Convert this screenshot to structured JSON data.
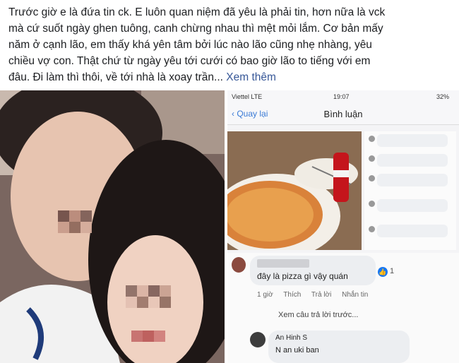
{
  "post": {
    "lines": [
      "Trước giờ e là đứa tin ck. E luôn quan niệm đã yêu là phải tin, hơn nữa là vck",
      "mà cứ suốt ngày ghen tuông, canh chừng nhau thì mệt mỏi lắm. Cơ bản mấy",
      "năm ở cạnh lão, em thấy khá yên tâm bởi lúc nào lão cũng nhẹ nhàng, yêu",
      "chiều vợ con. Thật chứ từ ngày yêu tới cưới có bao giờ lão to tiếng với em",
      "đâu. Đi làm thì thôi, về tới nhà là xoay trần..."
    ],
    "see_more": "Xem thêm"
  },
  "screenshot": {
    "carrier": "Viettel  LTE",
    "time": "19:07",
    "battery": "32%",
    "back_label": "Quay lại",
    "title": "Bình luận",
    "comment_text": "đây là pizza gì vậy quán",
    "reaction_count": "1",
    "actions": [
      "1 giờ",
      "Thích",
      "Trả lời",
      "Nhắn tin"
    ],
    "view_previous": "Xem câu trả lời trước...",
    "reply_name": "An Hinh S",
    "reply_text": "N          an uki ban"
  },
  "colors": {
    "link": "#385898",
    "text": "#1c1e21",
    "ios_blue": "#3b7bd6",
    "fb_blue": "#1877f2"
  }
}
